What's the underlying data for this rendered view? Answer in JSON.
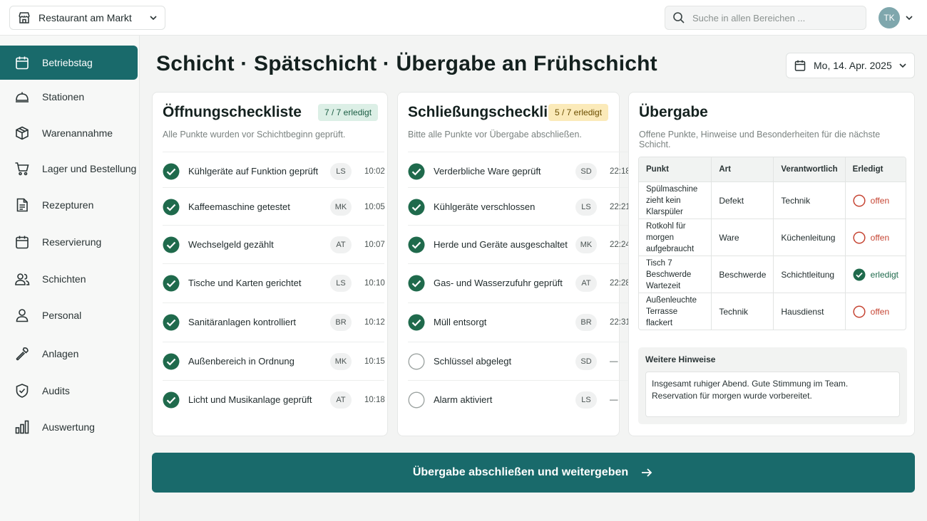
{
  "header": {
    "venue": "Restaurant am Markt",
    "search_placeholder": "Suche in allen Bereichen ...",
    "user_initials": "TK"
  },
  "sidebar": {
    "items": [
      {
        "label": "Betriebstag",
        "icon": "calendar-icon",
        "active": true
      },
      {
        "label": "Stationen",
        "icon": "cloche-icon"
      },
      {
        "label": "Warenannahme",
        "icon": "box-icon"
      },
      {
        "label": "Lager und Bestellung",
        "icon": "cart-icon"
      },
      {
        "label": "Rezepturen",
        "icon": "document-icon"
      },
      {
        "label": "Reservierung",
        "icon": "calendar-icon"
      },
      {
        "label": "Schichten",
        "icon": "users-icon"
      },
      {
        "label": "Personal",
        "icon": "user-icon"
      },
      {
        "label": "Anlagen",
        "icon": "wrench-icon"
      },
      {
        "label": "Audits",
        "icon": "shield-icon"
      },
      {
        "label": "Auswertung",
        "icon": "bar-chart-icon"
      }
    ]
  },
  "page": {
    "title": "Schicht · Spätschicht · Übergabe an Frühschicht",
    "date": "Mo, 14. Apr. 2025"
  },
  "opening": {
    "title": "Öffnungscheckliste",
    "badge": "7 / 7 erledigt",
    "subtitle": "Alle Punkte wurden vor Schichtbeginn geprüft.",
    "items": [
      {
        "label": "Kühlgeräte auf Funktion geprüft",
        "initials": "LS",
        "time": "10:02",
        "done": true
      },
      {
        "label": "Kaffeemaschine getestet",
        "initials": "MK",
        "time": "10:05",
        "done": true
      },
      {
        "label": "Wechselgeld gezählt",
        "initials": "AT",
        "time": "10:07",
        "done": true
      },
      {
        "label": "Tische und Karten gerichtet",
        "initials": "LS",
        "time": "10:10",
        "done": true
      },
      {
        "label": "Sanitäranlagen kontrolliert",
        "initials": "BR",
        "time": "10:12",
        "done": true
      },
      {
        "label": "Außenbereich in Ordnung",
        "initials": "MK",
        "time": "10:15",
        "done": true
      },
      {
        "label": "Licht und Musikanlage geprüft",
        "initials": "AT",
        "time": "10:18",
        "done": true
      }
    ]
  },
  "closing": {
    "title": "Schließungscheckliste",
    "badge": "5 / 7 erledigt",
    "subtitle": "Bitte alle Punkte vor Übergabe abschließen.",
    "items": [
      {
        "label": "Verderbliche Ware geprüft",
        "initials": "SD",
        "time": "22:18",
        "done": true
      },
      {
        "label": "Kühlgeräte verschlossen",
        "initials": "LS",
        "time": "22:21",
        "done": true
      },
      {
        "label": "Herde und Geräte ausgeschaltet",
        "initials": "MK",
        "time": "22:24",
        "done": true
      },
      {
        "label": "Gas- und Wasserzufuhr geprüft",
        "initials": "AT",
        "time": "22:28",
        "done": true
      },
      {
        "label": "Müll entsorgt",
        "initials": "BR",
        "time": "22:31",
        "done": true
      },
      {
        "label": "Schlüssel abgelegt",
        "initials": "SD",
        "time": "—",
        "done": false
      },
      {
        "label": "Alarm aktiviert",
        "initials": "LS",
        "time": "—",
        "done": false
      }
    ]
  },
  "handover": {
    "title": "Übergabe",
    "subtitle": "Offene Punkte, Hinweise und Besonderheiten für die nächste Schicht.",
    "columns": [
      "Punkt",
      "Art",
      "Verantwortlich",
      "Erledigt"
    ],
    "rows": [
      {
        "punkt": "Spülmaschine zieht kein Klarspüler",
        "art": "Defekt",
        "verantwortlich": "Technik",
        "status": "offen"
      },
      {
        "punkt": "Rotkohl für morgen aufgebraucht",
        "art": "Ware",
        "verantwortlich": "Küchenleitung",
        "status": "offen"
      },
      {
        "punkt": "Tisch 7 Beschwerde Wartezeit",
        "art": "Beschwerde",
        "verantwortlich": "Schichtleitung",
        "status": "erledigt"
      },
      {
        "punkt": "Außenleuchte Terrasse flackert",
        "art": "Technik",
        "verantwortlich": "Hausdienst",
        "status": "offen"
      }
    ],
    "notes_label": "Weitere Hinweise",
    "notes_text": "Insgesamt ruhiger Abend. Gute Stimmung im Team.\nReservation für morgen wurde vorbereitet."
  },
  "cta": {
    "label": "Übergabe abschließen und weitergeben"
  },
  "colors": {
    "primary": "#196a6b",
    "success": "#1f6a4c",
    "danger": "#c64533",
    "badge_green": "#dcefe6",
    "badge_yellow": "#fbeab9"
  }
}
